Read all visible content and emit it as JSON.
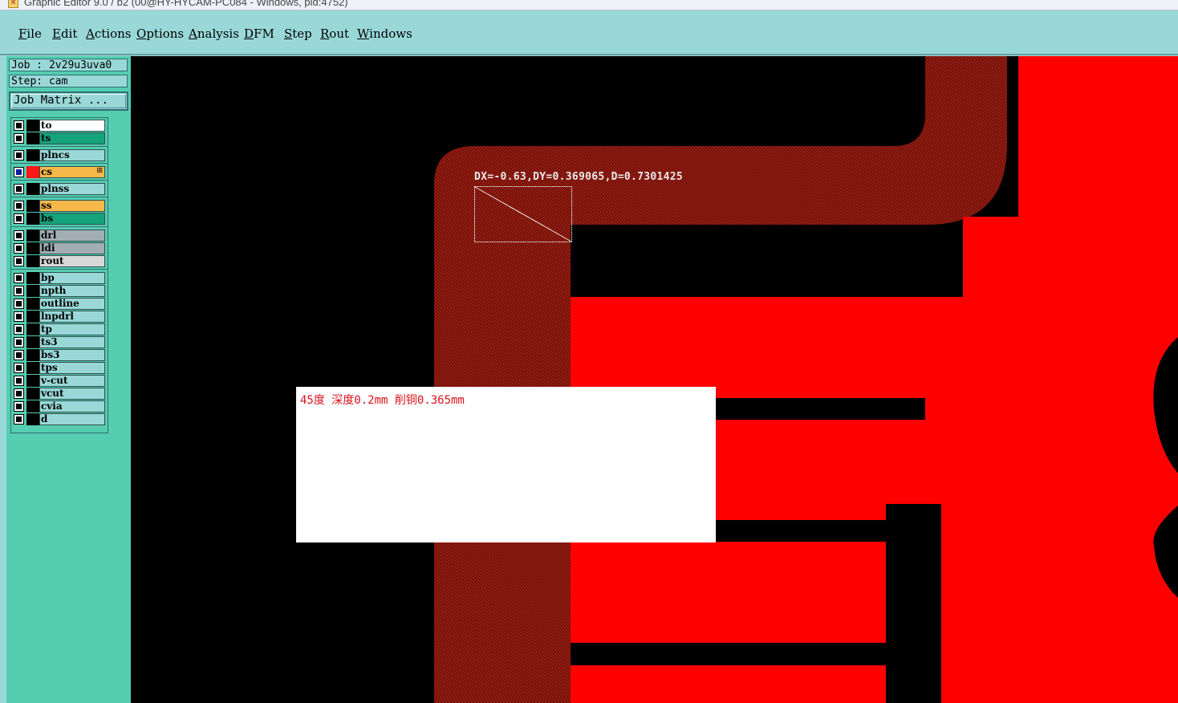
{
  "window": {
    "title": "Graphic Editor 9.0 / b2 (00@HY-HYCAM-PC084 - Windows, pid:4752)",
    "icon": "app-icon"
  },
  "menu": [
    {
      "label": "File"
    },
    {
      "label": "Edit"
    },
    {
      "label": "Actions"
    },
    {
      "label": "Options"
    },
    {
      "label": "Analysis"
    },
    {
      "label": "DFM"
    },
    {
      "label": "Step"
    },
    {
      "label": "Rout"
    },
    {
      "label": "Windows"
    }
  ],
  "panel": {
    "job": "Job : 2v29u3uva0",
    "step": "Step: cam",
    "job_matrix_label": "Job Matrix ...",
    "layers": [
      {
        "name": "to",
        "color": "#ffffff"
      },
      {
        "name": "ts",
        "color": "#14a37a"
      },
      {
        "name": "plncs",
        "color": "#9ad8d8"
      },
      {
        "name": "cs",
        "color": "#f7b84a",
        "active": true,
        "swatch": "#ff1616",
        "mark": "⊞"
      },
      {
        "name": "plnss",
        "color": "#9ad8d8"
      },
      {
        "name": "ss",
        "color": "#f7b84a"
      },
      {
        "name": "bs",
        "color": "#14a37a"
      },
      {
        "name": "drl",
        "color": "#a3aeb4"
      },
      {
        "name": "ldi",
        "color": "#a3aeb4"
      },
      {
        "name": "rout",
        "color": "#d8d8d8"
      },
      {
        "name": "bp",
        "color": "#9ad8d8"
      },
      {
        "name": "npth",
        "color": "#9ad8d8"
      },
      {
        "name": "outline",
        "color": "#9ad8d8"
      },
      {
        "name": "lnpdrl",
        "color": "#9ad8d8"
      },
      {
        "name": "tp",
        "color": "#9ad8d8"
      },
      {
        "name": "ts3",
        "color": "#9ad8d8"
      },
      {
        "name": "bs3",
        "color": "#9ad8d8"
      },
      {
        "name": "tps",
        "color": "#9ad8d8"
      },
      {
        "name": "v-cut",
        "color": "#9ad8d8"
      },
      {
        "name": "vcut",
        "color": "#9ad8d8"
      },
      {
        "name": "cvia",
        "color": "#9ad8d8"
      },
      {
        "name": "d",
        "color": "#9ad8d8"
      }
    ]
  },
  "canvas": {
    "measure": "DX=-0.63,DY=0.369065,D=0.7301425",
    "note": "45度 深度0.2mm  削铜0.365mm",
    "colors": {
      "copper": "#ff0000",
      "hatched_trace": "#7a1208",
      "background": "#000000"
    }
  }
}
